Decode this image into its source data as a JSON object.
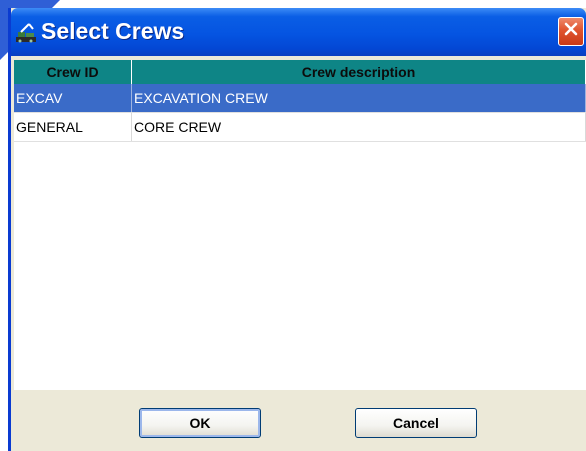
{
  "window": {
    "title": "Select Crews",
    "icon": "construction-crew-icon",
    "close_icon": "close-icon"
  },
  "table": {
    "columns": [
      "Crew ID",
      "Crew description"
    ],
    "rows": [
      {
        "id": "EXCAV",
        "description": "EXCAVATION CREW",
        "selected": true
      },
      {
        "id": "GENERAL",
        "description": "CORE CREW",
        "selected": false
      }
    ]
  },
  "buttons": {
    "ok_label": "OK",
    "cancel_label": "Cancel"
  },
  "colors": {
    "titlebar": "#0554e1",
    "header": "#0e8586",
    "selection": "#3a6bc8",
    "close": "#e0542e"
  }
}
